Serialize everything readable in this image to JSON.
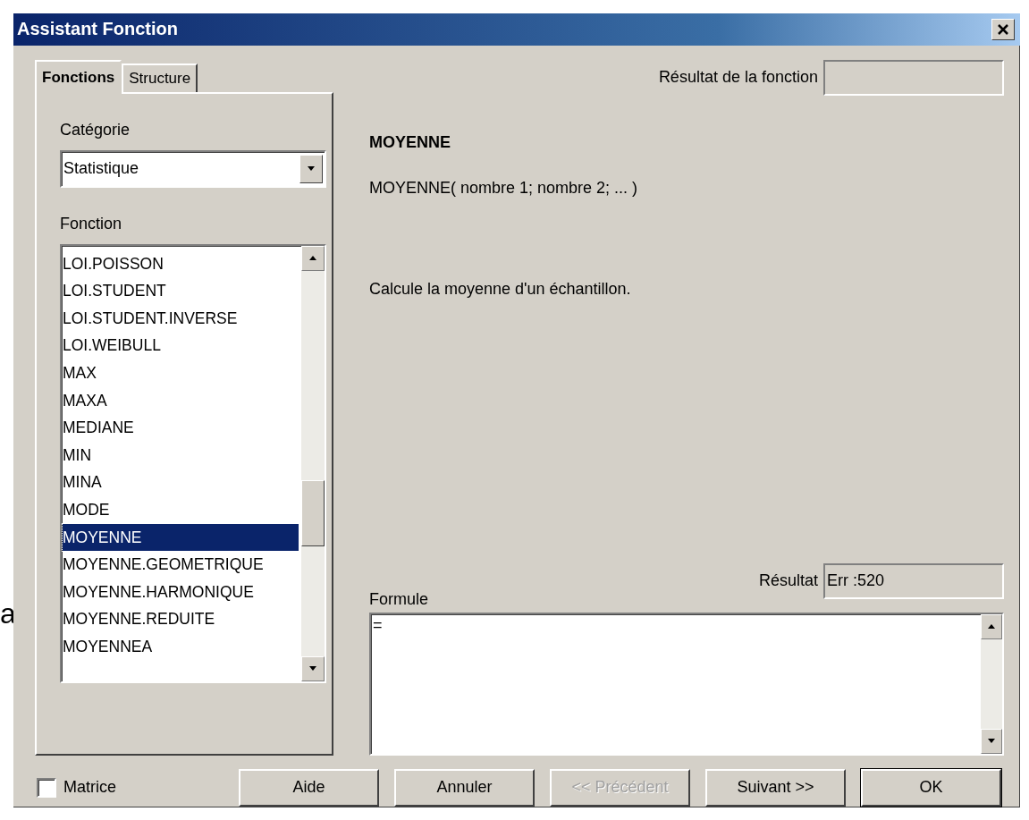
{
  "background_text": "a",
  "window": {
    "title": "Assistant Fonction"
  },
  "tabs": [
    {
      "label": "Fonctions",
      "selected": true
    },
    {
      "label": "Structure",
      "selected": false
    }
  ],
  "category": {
    "label": "Catégorie",
    "value": "Statistique"
  },
  "function_list": {
    "label": "Fonction",
    "items": [
      {
        "label": "LOI.POISSON",
        "selected": false
      },
      {
        "label": "LOI.STUDENT",
        "selected": false
      },
      {
        "label": "LOI.STUDENT.INVERSE",
        "selected": false
      },
      {
        "label": "LOI.WEIBULL",
        "selected": false
      },
      {
        "label": "MAX",
        "selected": false
      },
      {
        "label": "MAXA",
        "selected": false
      },
      {
        "label": "MEDIANE",
        "selected": false
      },
      {
        "label": "MIN",
        "selected": false
      },
      {
        "label": "MINA",
        "selected": false
      },
      {
        "label": "MODE",
        "selected": false
      },
      {
        "label": "MOYENNE",
        "selected": true
      },
      {
        "label": "MOYENNE.GEOMETRIQUE",
        "selected": false
      },
      {
        "label": "MOYENNE.HARMONIQUE",
        "selected": false
      },
      {
        "label": "MOYENNE.REDUITE",
        "selected": false
      },
      {
        "label": "MOYENNEA",
        "selected": false
      }
    ]
  },
  "function_result": {
    "label": "Résultat de la fonction"
  },
  "function_name": "MOYENNE",
  "syntax": "MOYENNE( nombre 1; nombre 2; ... )",
  "description": "Calcule la moyenne d'un échantillon.",
  "result": {
    "label": "Résultat",
    "value": "Err :520"
  },
  "formula": {
    "label": "Formule",
    "value": "="
  },
  "matrix": {
    "label": "Matrice",
    "checked": false
  },
  "buttons": [
    {
      "label": "Aide",
      "disabled": false,
      "default": false
    },
    {
      "label": "Annuler",
      "disabled": false,
      "default": false
    },
    {
      "label": "<< Précédent",
      "disabled": true,
      "default": false
    },
    {
      "label": "Suivant >>",
      "disabled": false,
      "default": false
    },
    {
      "label": "OK",
      "disabled": false,
      "default": true
    }
  ]
}
